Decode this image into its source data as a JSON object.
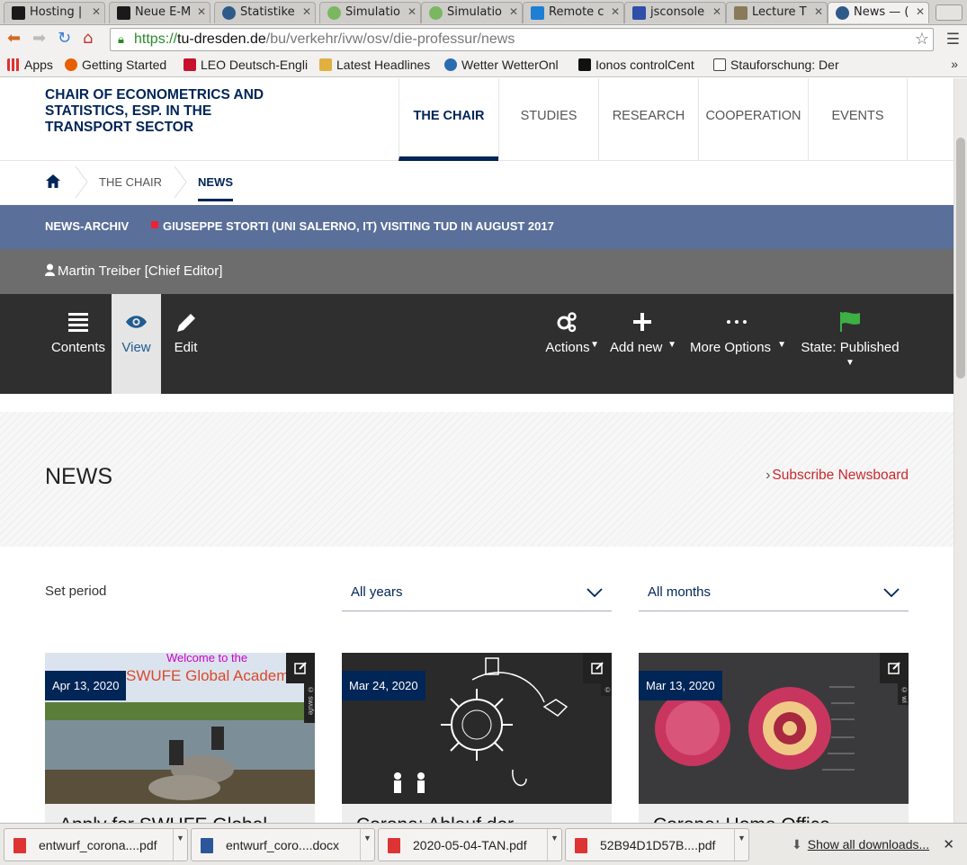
{
  "browser": {
    "tabs": [
      {
        "label": "Hosting |",
        "color": "#1a1a1a",
        "glyph": "I"
      },
      {
        "label": "Neue E-M",
        "color": "#1a1a1a",
        "glyph": "I"
      },
      {
        "label": "Statistike",
        "color": "#2e5a8a",
        "glyph": "◎"
      },
      {
        "label": "Simulatio",
        "color": "#7bb661",
        "glyph": "☉"
      },
      {
        "label": "Simulatio",
        "color": "#7bb661",
        "glyph": "☉"
      },
      {
        "label": "Remote c",
        "color": "#1f7fd4",
        "glyph": "▤"
      },
      {
        "label": "jsconsole",
        "color": "#2f4fa8",
        "glyph": "❯"
      },
      {
        "label": "Lecture T",
        "color": "#8a7a5a",
        "glyph": "▓"
      },
      {
        "label": "News — (",
        "color": "#2e5a8a",
        "glyph": "◎",
        "active": true
      }
    ],
    "url": {
      "protocol": "https://",
      "host": "tu-dresden.de",
      "path": "/bu/verkehr/ivw/osv/die-professur/news"
    },
    "bookmarks": [
      {
        "label": "Apps",
        "color": "#d33"
      },
      {
        "label": "Getting Started",
        "color": "#e66000"
      },
      {
        "label": "LEO Deutsch-Engli",
        "color": "#c8102e"
      },
      {
        "label": "Latest Headlines",
        "color": "#e0b040"
      },
      {
        "label": "Wetter WetterOnl",
        "color": "#2b6cb0"
      },
      {
        "label": "Ionos controlCent",
        "color": "#111"
      },
      {
        "label": "Stauforschung: Der",
        "color": "#444"
      }
    ],
    "bookmarks_more": "»"
  },
  "site": {
    "title": "CHAIR OF ECONOMETRICS AND STATISTICS, ESP. IN THE TRANSPORT SECTOR",
    "nav": [
      "THE CHAIR",
      "STUDIES",
      "RESEARCH",
      "COOPERATION",
      "EVENTS"
    ],
    "nav_active": "THE CHAIR",
    "breadcrumb": [
      "THE CHAIR",
      "NEWS"
    ],
    "newsbar": {
      "label": "NEWS-ARCHIV",
      "headline": "GIUSEPPE STORTI (UNI SALERNO, IT) VISITING TUD IN AUGUST 2017"
    },
    "editor": "Martin Treiber [Chief Editor]"
  },
  "plone": {
    "left": [
      {
        "label": "Contents",
        "icon": "list-icon"
      },
      {
        "label": "View",
        "icon": "eye-icon",
        "active": true
      },
      {
        "label": "Edit",
        "icon": "pencil-icon"
      }
    ],
    "right": [
      {
        "label": "Actions",
        "icon": "gears-icon"
      },
      {
        "label": "Add new",
        "icon": "plus-icon"
      },
      {
        "label": "More Options",
        "icon": "dots-icon"
      },
      {
        "label": "State: Published",
        "icon": "flag-icon"
      }
    ],
    "state_color": "#3cb043"
  },
  "news": {
    "title": "NEWS",
    "subscribe": "Subscribe Newsboard",
    "set_period": "Set period",
    "year_select": "All years",
    "month_select": "All months",
    "cards": [
      {
        "date": "Apr 13, 2020",
        "title": "Apply for SWUFE Global",
        "credit": "© swufe",
        "image_text_1": "Welcome to the",
        "image_text_2": "SWUFE Global Academ"
      },
      {
        "date": "Mar 24, 2020",
        "title": "Corona: Ablauf der",
        "credit": "©"
      },
      {
        "date": "Mar 13, 2020",
        "title": "Corona: Home Office",
        "credit": "© wi"
      }
    ]
  },
  "downloads": {
    "items": [
      {
        "name": "entwurf_corona....pdf",
        "color": "#d33"
      },
      {
        "name": "entwurf_coro....docx",
        "color": "#2b579a"
      },
      {
        "name": "2020-05-04-TAN.pdf",
        "color": "#d33"
      },
      {
        "name": "52B94D1D57B....pdf",
        "color": "#d33"
      }
    ],
    "show_all": "Show all downloads..."
  }
}
